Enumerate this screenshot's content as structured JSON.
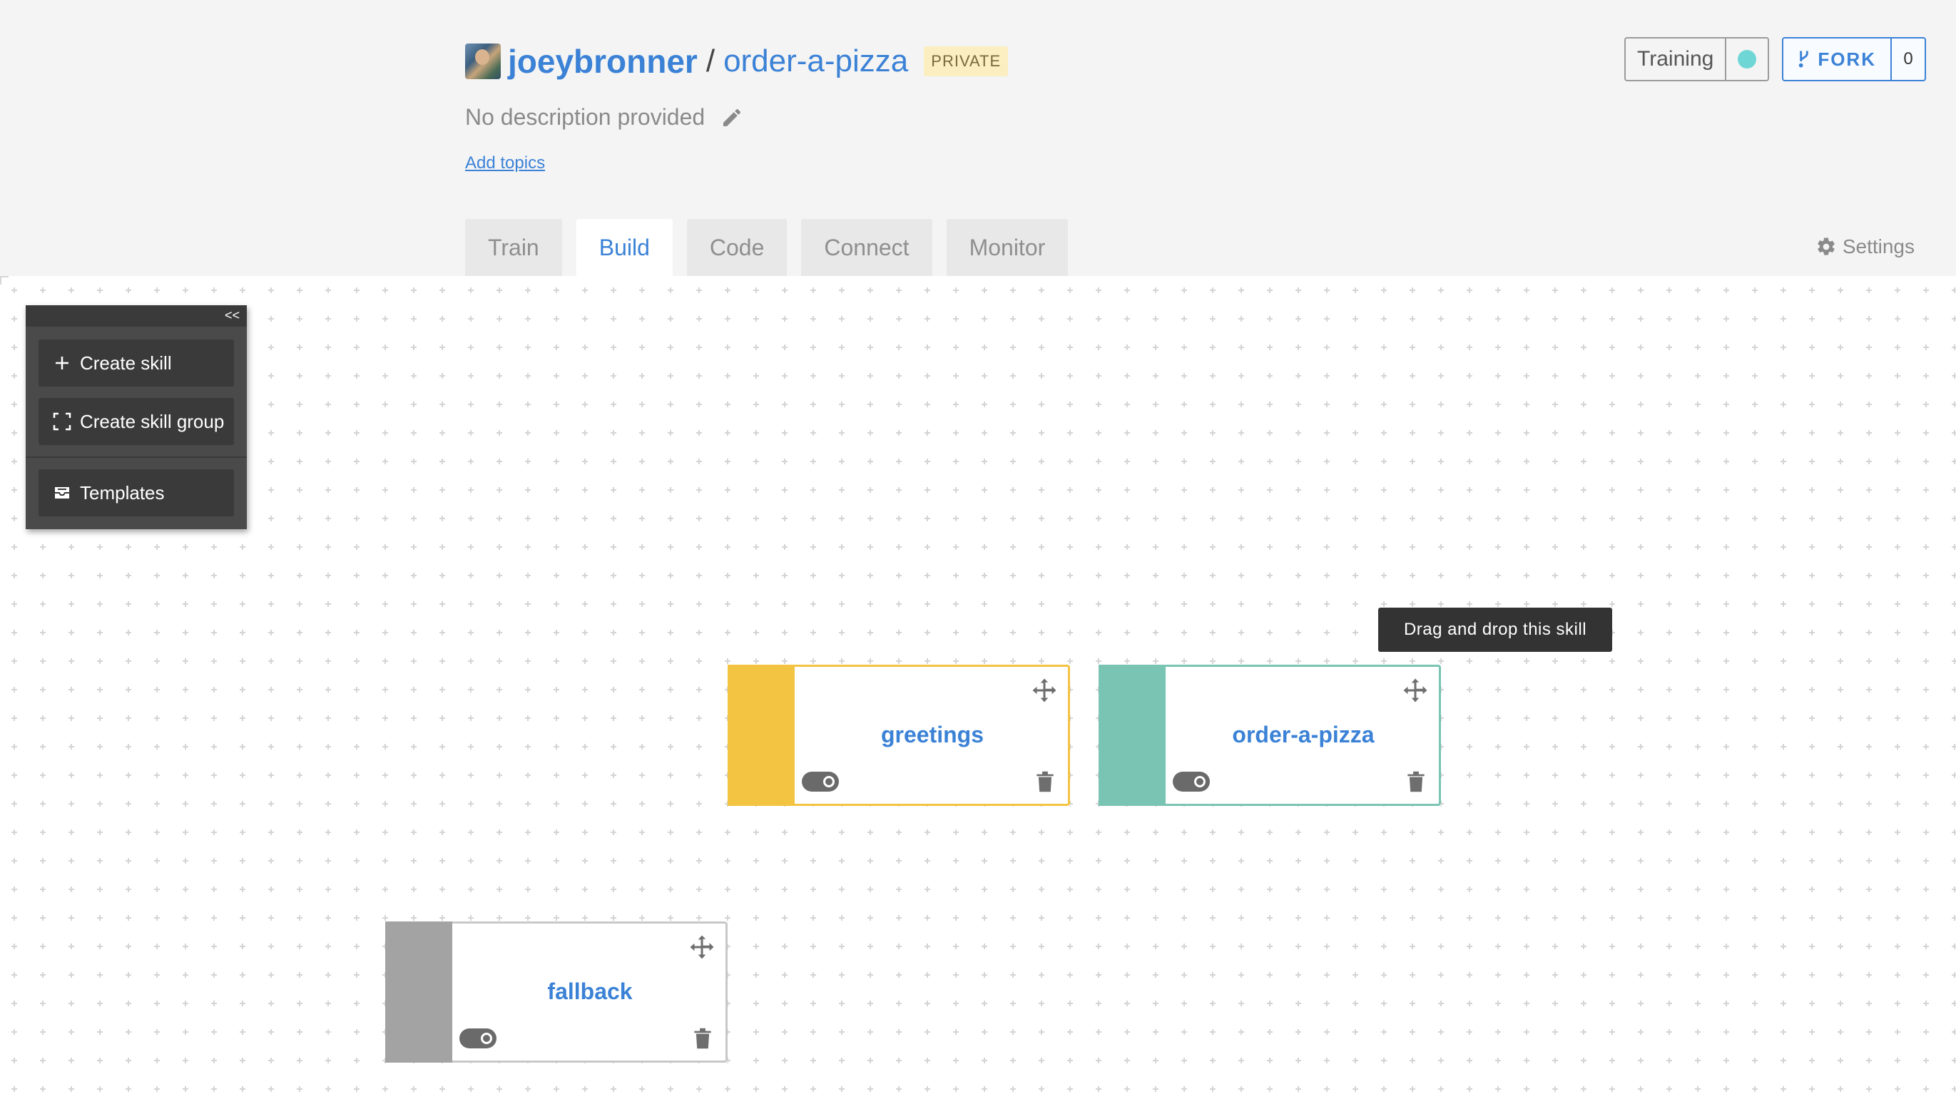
{
  "repo": {
    "owner": "joeybronner",
    "separator": "/",
    "name": "order-a-pizza",
    "visibility": "PRIVATE",
    "description": "No description provided",
    "add_topics": "Add topics"
  },
  "status": {
    "training_label": "Training",
    "training_dot_color": "#6fd6d6",
    "fork_label": "FORK",
    "fork_count": "0"
  },
  "tabs": [
    {
      "label": "Train",
      "active": false
    },
    {
      "label": "Build",
      "active": true
    },
    {
      "label": "Code",
      "active": false
    },
    {
      "label": "Connect",
      "active": false
    },
    {
      "label": "Monitor",
      "active": false
    }
  ],
  "settings_label": "Settings",
  "toolbox": {
    "collapse_label": "<<",
    "create_skill": "Create skill",
    "create_skill_group": "Create skill group",
    "templates": "Templates"
  },
  "skills": [
    {
      "name": "greetings",
      "color": "#f3c342"
    },
    {
      "name": "order-a-pizza",
      "color": "#79c4b2"
    },
    {
      "name": "fallback",
      "color": "#a3a3a3"
    }
  ],
  "tooltip": "Drag and drop this skill"
}
